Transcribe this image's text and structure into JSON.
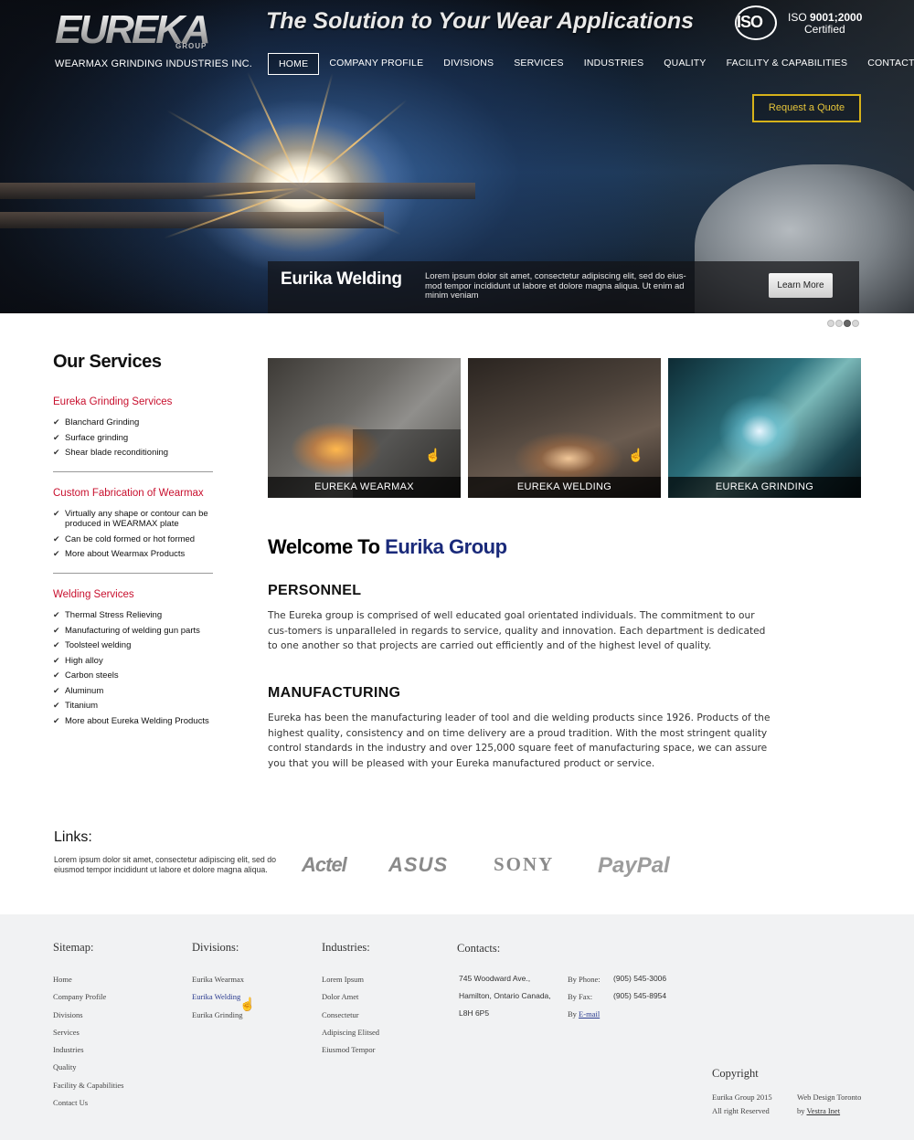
{
  "header": {
    "logo_text": "EUREKA",
    "logo_group": "GROUP",
    "company": "WEARMAX GRINDING INDUSTRIES INC.",
    "tagline": "The Solution to Your Wear Applications",
    "iso_word": "ISO",
    "iso_prefix": "ISO",
    "iso_standard": "9001;2000",
    "iso_certified": "Certified"
  },
  "nav": [
    {
      "label": "HOME",
      "active": true
    },
    {
      "label": "COMPANY PROFILE"
    },
    {
      "label": "DIVISIONS"
    },
    {
      "label": "SERVICES"
    },
    {
      "label": "INDUSTRIES"
    },
    {
      "label": "QUALITY"
    },
    {
      "label": "FACILITY & CAPABILITIES"
    },
    {
      "label": "CONTACT US"
    }
  ],
  "quote_button": "Request a Quote",
  "slide": {
    "title": "Eurika Welding",
    "text": "Lorem ipsum dolor sit amet, consectetur adipiscing elit, sed do eius-mod tempor incididunt ut labore et dolore magna aliqua. Ut enim ad minim veniam",
    "button": "Learn More",
    "dots_total": 4,
    "active_dot": 3
  },
  "sidebar": {
    "heading": "Our Services",
    "groups": [
      {
        "title": "Eureka Grinding Services",
        "items": [
          "Blanchard Grinding",
          "Surface grinding",
          "Shear blade reconditioning"
        ]
      },
      {
        "title": "Custom Fabrication of Wearmax",
        "items": [
          "Virtually any shape or contour can be produced in WEARMAX plate",
          "Can be cold formed or hot formed",
          "More about Wearmax Products"
        ]
      },
      {
        "title": "Welding Services",
        "items": [
          "Thermal Stress Relieving",
          "Manufacturing of welding gun parts",
          "Toolsteel welding",
          "High alloy",
          "Carbon steels",
          "Aluminum",
          "Titanium",
          "More about Eureka Welding Products"
        ]
      }
    ]
  },
  "tiles": [
    "EUREKA WEARMAX",
    "EUREKA WELDING",
    "EUREKA GRINDING"
  ],
  "welcome": {
    "prefix": "Welcome To ",
    "accent": "Eurika Group"
  },
  "sections": {
    "personnel_title": "PERSONNEL",
    "personnel_text": "The Eureka group is comprised of well educated goal orientated individuals. The commitment to our cus-tomers is unparalleled in regards to service, quality and innovation. Each department is dedicated to one another so that projects are carried out efficiently and of the highest level of quality.",
    "manufacturing_title": "MANUFACTURING",
    "manufacturing_text": "Eureka has been the manufacturing leader of tool and die welding products since 1926. Products of the highest quality, consistency and on time delivery are a proud tradition. With the most stringent quality control standards in the industry and over 125,000 square feet of manufacturing space, we can assure you that you will be pleased with your Eureka manufactured product or service."
  },
  "links": {
    "title": "Links:",
    "text": "Lorem ipsum dolor sit amet, consectetur adipiscing elit, sed do eiusmod tempor incididunt ut labore et dolore magna aliqua.",
    "brands": [
      "Actel",
      "ASUS",
      "SONY",
      "PayPal"
    ]
  },
  "footer": {
    "sitemap_title": "Sitemap:",
    "sitemap": [
      "Home",
      "Company Profile",
      "Divisions",
      "Services",
      "Industries",
      "Quality",
      "Facility & Capabilities",
      "Contact Us"
    ],
    "divisions_title": "Divisions:",
    "divisions": [
      "Eurika Wearmax",
      "Eurika Welding",
      "Eurika Grinding"
    ],
    "industries_title": "Industries:",
    "industries": [
      "Lorem Ipsum",
      "Dolor Amet",
      "Consectetur",
      "Adipiscing Elitsed",
      "Eiusmod Tempor"
    ],
    "contacts_title": "Contacts:",
    "address": [
      "745 Woodward Ave.,",
      "Hamilton, Ontario Canada,",
      "L8H 6P5"
    ],
    "phone_label": "By Phone:",
    "phone": "(905) 545-3006",
    "fax_label": "By Fax:",
    "fax": "(905) 545-8954",
    "email_prefix": "By",
    "email": "E-mail",
    "copyright_title": "Copyright",
    "copyright_lines": [
      "Eurika Group 2015",
      "All right Reserved"
    ],
    "design_line": "Web Design Toronto",
    "design_by": "by",
    "design_company": "Vestra Inet"
  }
}
